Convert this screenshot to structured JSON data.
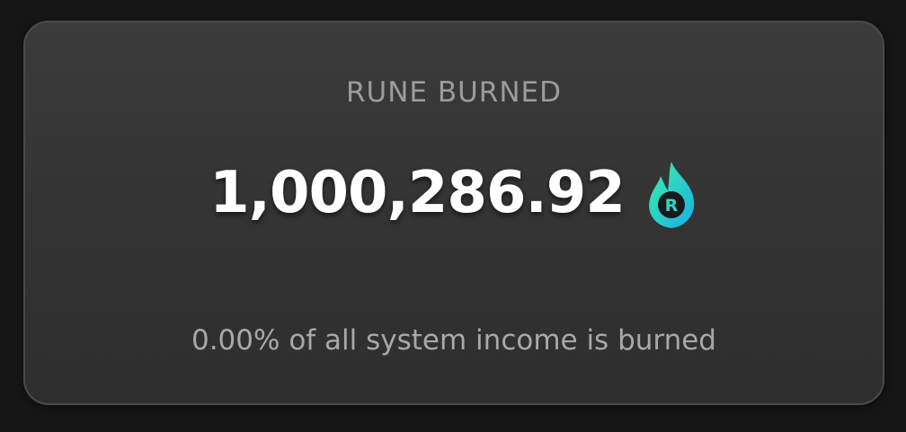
{
  "card": {
    "title": "RUNE BURNED",
    "value": "1,000,286.92",
    "subtitle": "0.00% of all system income is burned",
    "icon": "rune-flame-icon",
    "icon_letter": "R",
    "colors": {
      "background": "#161616",
      "card": "#363636",
      "title": "#9c9c9c",
      "value": "#ffffff",
      "subtitle": "#a8a8a8",
      "flame_start": "#35e8b8",
      "flame_end": "#1fb5e6",
      "icon_core": "#1a1a1a"
    }
  }
}
